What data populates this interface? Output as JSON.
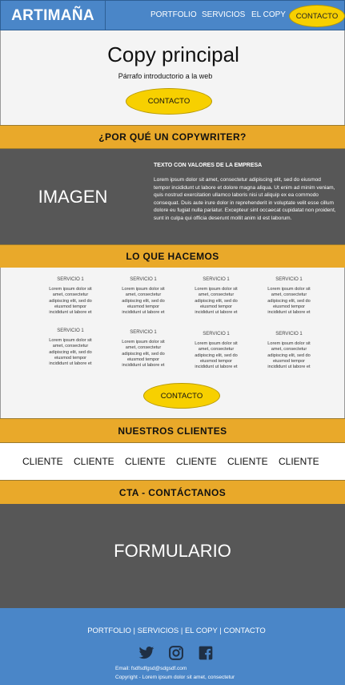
{
  "header": {
    "logo": "ARTIMAÑA",
    "nav": [
      "PORTFOLIO",
      "SERVICIOS",
      "EL COPY"
    ],
    "cta": "CONTACTO"
  },
  "hero": {
    "title": "Copy principal",
    "subtitle": "Párrafo introductorio a la web",
    "button": "CONTACTO"
  },
  "why": {
    "heading": "¿POR QUÉ UN COPYWRITER?",
    "image_label": "IMAGEN",
    "values_title": "TEXTO CON VALORES DE LA EMPRESA",
    "values_text": "Lorem ipsum dolor sit amet, consectetur adipiscing elit, sed do eiusmod tempor incididunt ut labore et dolore magna aliqua. Ut enim ad minim veniam, quis nostrud exercitation ullamco laboris nisi ut aliquip ex ea commodo consequat. Duis aute irure dolor in reprehenderit in voluptate velit esse cillum dolore eu fugiat nulla pariatur. Excepteur sint occaecat cupidatat non proident, sunt in culpa qui officia deserunt mollit anim id est laborum."
  },
  "services": {
    "heading": "LO QUE HACEMOS",
    "items": [
      {
        "title": "SERVICIO 1",
        "text": "Lorem ipsum dolor sit amet, consectetur adipiscing elit, sed do eiusmod tempor incididunt ut labore et"
      },
      {
        "title": "SERVICIO 1",
        "text": "Lorem ipsum dolor sit amet, consectetur adipiscing elit, sed do eiusmod tempor incididunt ut labore et"
      },
      {
        "title": "SERVICIO 1",
        "text": "Lorem ipsum dolor sit amet, consectetur adipiscing elit, sed do eiusmod tempor incididunt ut labore et"
      },
      {
        "title": "SERVICIO 1",
        "text": "Lorem ipsum dolor sit amet, consectetur adipiscing elit, sed do eiusmod tempor incididunt ut labore et"
      },
      {
        "title": "SERVICIO 1",
        "text": "Lorem ipsum dolor sit amet, consectetur adipiscing elit, sed do eiusmod tempor incididunt ut labore et"
      },
      {
        "title": "SERVICIO 1",
        "text": "Lorem ipsum dolor sit amet, consectetur adipiscing elit, sed do eiusmod tempor incididunt ut labore et"
      },
      {
        "title": "SERVICIO 1",
        "text": "Lorem ipsum dolor sit amet, consectetur adipiscing elit, sed do eiusmod tempor incididunt ut labore et"
      },
      {
        "title": "SERVICIO 1",
        "text": "Lorem ipsum dolor sit amet, consectetur adipiscing elit, sed do eiusmod tempor incididunt ut labore et"
      }
    ],
    "button": "CONTACTO"
  },
  "clients": {
    "heading": "NUESTROS CLIENTES",
    "items": [
      "CLIENTE",
      "CLIENTE",
      "CLIENTE",
      "CLIENTE",
      "CLIENTE",
      "CLIENTE"
    ]
  },
  "cta": {
    "heading": "CTA - CONTÁCTANOS",
    "form_label": "FORMULARIO"
  },
  "footer": {
    "links": "PORTFOLIO | SERVICIOS | EL COPY | CONTACTO",
    "social_icons": [
      "twitter-icon",
      "instagram-icon",
      "facebook-icon"
    ],
    "email": "Email: fsdfsdfgsd@sdgsdf.com",
    "copyright": "Copyright - Lorem ipsum dolor sit amet, consectetur"
  },
  "colors": {
    "header_blue": "#4a86c8",
    "band_orange": "#e9a92a",
    "button_yellow": "#f7d000",
    "dark_gray": "#575757",
    "light_gray": "#f4f4f4"
  }
}
